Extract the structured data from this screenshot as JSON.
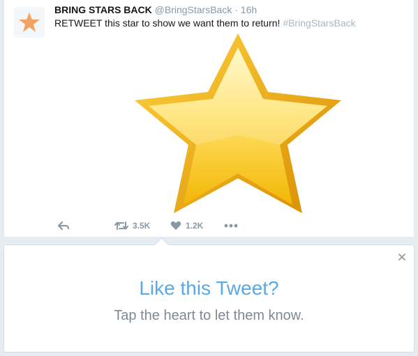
{
  "tweet": {
    "display_name": "BRING STARS BACK",
    "handle": "@BringStarsBack",
    "separator": "·",
    "timestamp": "16h",
    "text": "RETWEET this star to show we want them to return!",
    "hashtag": "#BringStarsBack",
    "avatar_icon": "star-icon",
    "media_icon": "gold-star-icon",
    "accent_color": "#f4a261"
  },
  "actions": {
    "reply_icon": "reply-icon",
    "retweet_icon": "retweet-icon",
    "retweet_count": "3.5K",
    "like_icon": "heart-icon",
    "like_count": "1.2K",
    "more_icon": "more-icon"
  },
  "prompt": {
    "title": "Like this Tweet?",
    "subtitle": "Tap the heart to let them know.",
    "close_icon": "close-icon",
    "title_color": "#5aa9e6"
  }
}
